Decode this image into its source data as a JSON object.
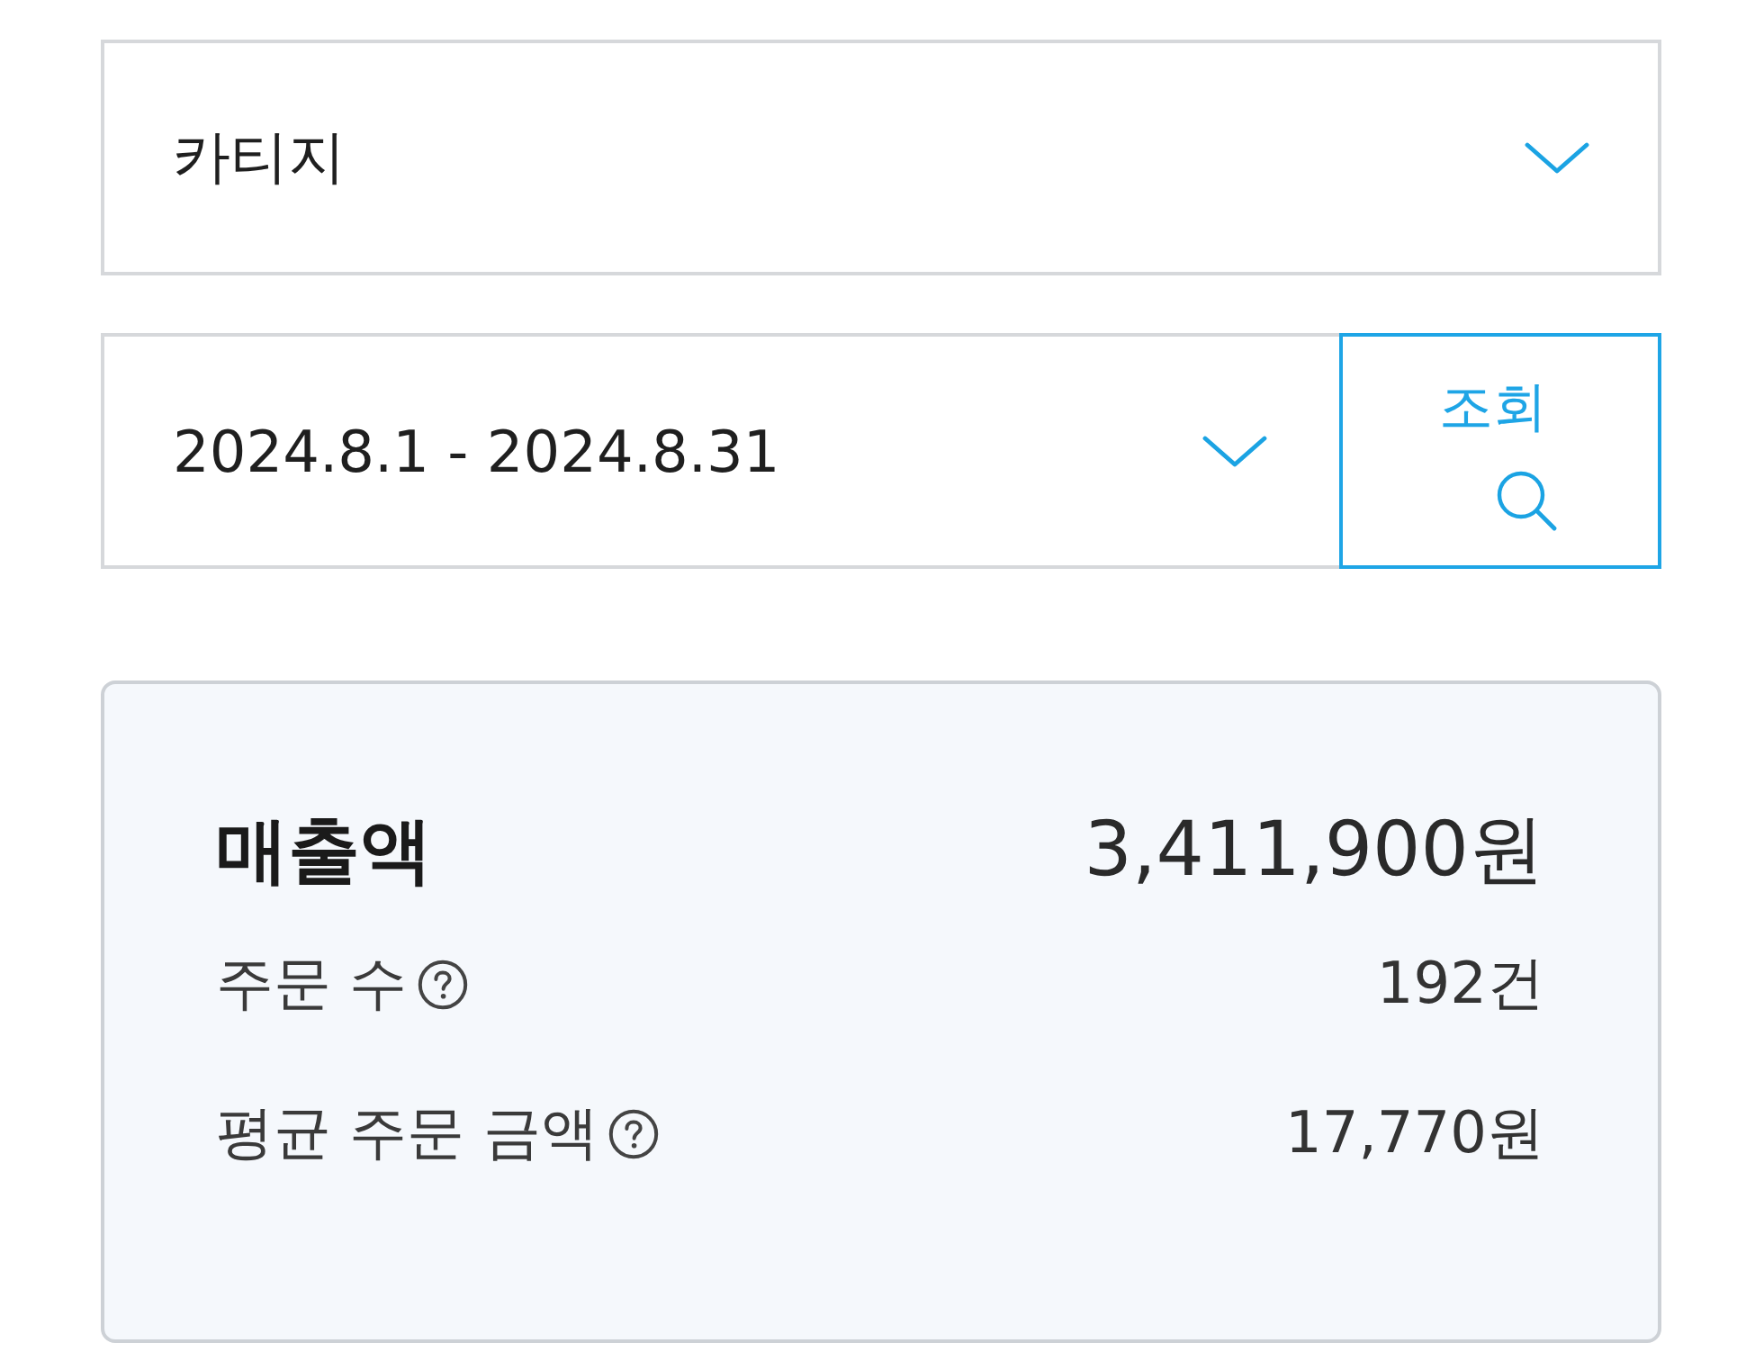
{
  "filters": {
    "category": {
      "value": "카티지"
    },
    "period": {
      "value": "2024.8.1 - 2024.8.31"
    },
    "search_button": {
      "label": "조회"
    }
  },
  "summary": {
    "title": "매출액",
    "total": "3,411,900원",
    "rows": [
      {
        "label": "주문 수",
        "value": "192건",
        "info": true
      },
      {
        "label": "평균 주문 금액",
        "value": "17,770원",
        "info": true
      }
    ]
  }
}
